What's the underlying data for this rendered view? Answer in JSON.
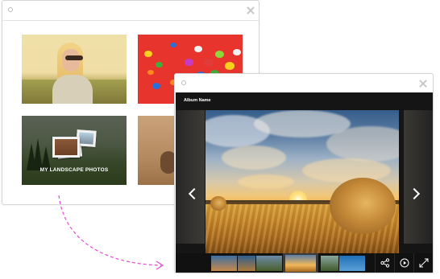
{
  "back_window": {
    "thumbnails": [
      {
        "id": "portrait"
      },
      {
        "id": "candy"
      },
      {
        "id": "landscape-album",
        "caption": "MY LANDSCAPE PHOTOS"
      },
      {
        "id": "cat"
      }
    ]
  },
  "lightbox": {
    "album_name": "Album Name",
    "filmstrip_count": 6,
    "active_thumbnail_index": 3,
    "toolbar_icons": [
      "share-icon",
      "play-icon",
      "fullscreen-icon"
    ]
  },
  "colors": {
    "arrow": "#e44ad2",
    "viewer_bg": "#151515",
    "candy_bg": "#e7352e"
  }
}
